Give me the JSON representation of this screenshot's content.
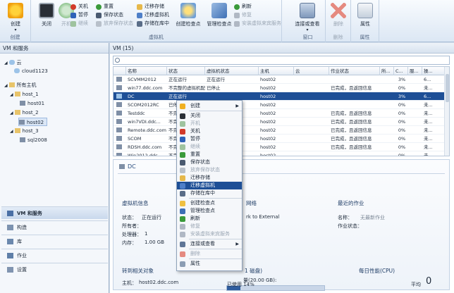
{
  "ribbon": {
    "create": {
      "label": "创建",
      "group": "创建"
    },
    "close": "关闭",
    "start": "开机",
    "shutdown": "关机",
    "pause": "暂停",
    "resume": "继续",
    "reset": "重置",
    "save_state": "保存状态",
    "discard_saved": "放弃保存状态",
    "migrate_storage": "迁移存储",
    "migrate_vm": "迁移虚拟机",
    "store_library": "存储在库中",
    "create_checkpoint": "创建检查点",
    "manage_checkpoint": "管理检查点",
    "refresh": "刷新",
    "repair": "修复",
    "install_integration": "安装虚拟来宾服务",
    "vm_group": "虚拟机",
    "connect_view": "连接或查看",
    "window_group": "窗口",
    "delete": "删除",
    "delete_group": "删除",
    "properties": "属性",
    "properties_group": "属性"
  },
  "nav": {
    "title": "VM 和服务",
    "tree": [
      {
        "label": "云",
        "level": 0
      },
      {
        "label": "cloud1123",
        "level": 1
      },
      {
        "label": "所有主机",
        "level": 0
      },
      {
        "label": "host_1",
        "level": 1
      },
      {
        "label": "host01",
        "level": 2
      },
      {
        "label": "host_2",
        "level": 1
      },
      {
        "label": "host02",
        "level": 2
      },
      {
        "label": "host_3",
        "level": 1
      },
      {
        "label": "sql2008",
        "level": 2
      }
    ],
    "workspaces": [
      {
        "label": "VM 和服务"
      },
      {
        "label": "构造"
      },
      {
        "label": "库"
      },
      {
        "label": "作业"
      },
      {
        "label": "设置"
      }
    ]
  },
  "main": {
    "title": "VM (15)",
    "search_placeholder": "",
    "columns": [
      "名称",
      "状态",
      "虚拟机状态",
      "主机",
      "云",
      "作业状态",
      "所...",
      "C...",
      "服...",
      "操..."
    ],
    "rows": [
      {
        "name": "SCVMM2012",
        "status": "正在运行",
        "vmstate": "正在运行",
        "host": "host02",
        "job": "",
        "cpu": "3%",
        "svc": "6..."
      },
      {
        "name": "win77.ddc.com",
        "status": "不完整的虚拟机配置",
        "vmstate": "已停止",
        "host": "host02",
        "job": "已完成，且返回信息",
        "cpu": "0%",
        "svc": "未..."
      },
      {
        "name": "DC",
        "status": "正在运行",
        "vmstate": "",
        "host": "host02",
        "job": "",
        "cpu": "3%",
        "svc": "6..."
      },
      {
        "name": "SCOM2012RC",
        "status": "已停",
        "vmstate": "",
        "host": "host02",
        "job": "",
        "cpu": "0%",
        "svc": "未..."
      },
      {
        "name": "Testddc",
        "status": "不完",
        "vmstate": "",
        "host": "host02",
        "job": "已完成，且返回信息",
        "cpu": "0%",
        "svc": "未..."
      },
      {
        "name": "win7VDI.ddc...",
        "status": "不完",
        "vmstate": "",
        "host": "host02",
        "job": "已完成，且返回信息",
        "cpu": "0%",
        "svc": "未..."
      },
      {
        "name": "Remote.ddc.com",
        "status": "不完",
        "vmstate": "",
        "host": "host02",
        "job": "已完成，且返回信息",
        "cpu": "0%",
        "svc": "未..."
      },
      {
        "name": "SCOM",
        "status": "不完",
        "vmstate": "",
        "host": "host02",
        "job": "已完成，且返回信息",
        "cpu": "0%",
        "svc": "未..."
      },
      {
        "name": "RDSH.ddc.com",
        "status": "不完",
        "vmstate": "",
        "host": "host02",
        "job": "已完成，且返回信息",
        "cpu": "0%",
        "svc": "未..."
      },
      {
        "name": "Win2012.ddc...",
        "status": "不完",
        "vmstate": "",
        "host": "host02",
        "job": "",
        "cpu": "0%",
        "svc": "未..."
      }
    ]
  },
  "detail": {
    "vm_name": "DC",
    "vm_info_title": "虚拟机信息",
    "state_label": "状态：",
    "state_value": "正在运行",
    "owner_label": "所有者：",
    "cpu_label": "处理器：",
    "cpu_value": "1",
    "mem_label": "内存：",
    "mem_value": "1.00 GB",
    "network_title": "网络",
    "network_value": "rk to External",
    "recent_job_title": "最近的作业",
    "job_name_label": "名称：",
    "job_name_value": "无最新作业",
    "job_status_label": "作业状态：",
    "related_title": "转到相关对象",
    "host_label": "主机：",
    "host_value": "host02.ddc.com",
    "disk_title": "1 磁盘)",
    "disk_size": "量(20.00 GB):",
    "disk_used": "已使用 14%",
    "disk_used_pct": 14,
    "perf_title": "每日性能(CPU)",
    "avg_label": "平均",
    "avg_value": "0"
  },
  "context_menu": {
    "items": [
      {
        "label": "创建",
        "disabled": false,
        "submenu": true
      },
      {
        "label": "关闭",
        "disabled": false
      },
      {
        "label": "开机",
        "disabled": true
      },
      {
        "label": "关机",
        "disabled": false
      },
      {
        "label": "暂停",
        "disabled": false
      },
      {
        "label": "继续",
        "disabled": true
      },
      {
        "label": "重置",
        "disabled": false
      },
      {
        "label": "保存状态",
        "disabled": false
      },
      {
        "label": "放弃保存状态",
        "disabled": true
      },
      {
        "label": "迁移存储",
        "disabled": false
      },
      {
        "label": "迁移虚拟机",
        "disabled": false,
        "highlighted": true
      },
      {
        "label": "存储在库中",
        "disabled": false
      },
      {
        "label": "创建检查点",
        "disabled": false
      },
      {
        "label": "管理检查点",
        "disabled": false
      },
      {
        "label": "刷新",
        "disabled": false
      },
      {
        "label": "修复",
        "disabled": true
      },
      {
        "label": "安装虚拟来宾服务",
        "disabled": true
      },
      {
        "label": "连接或查看",
        "disabled": false,
        "submenu": true
      },
      {
        "label": "删除",
        "disabled": true
      },
      {
        "label": "属性",
        "disabled": false
      }
    ]
  },
  "colors": {
    "selection": "#1e4f96",
    "ribbon_bg": "#dce7f4",
    "accent_red": "#d23a2a",
    "accent_green": "#3a9a3a"
  }
}
